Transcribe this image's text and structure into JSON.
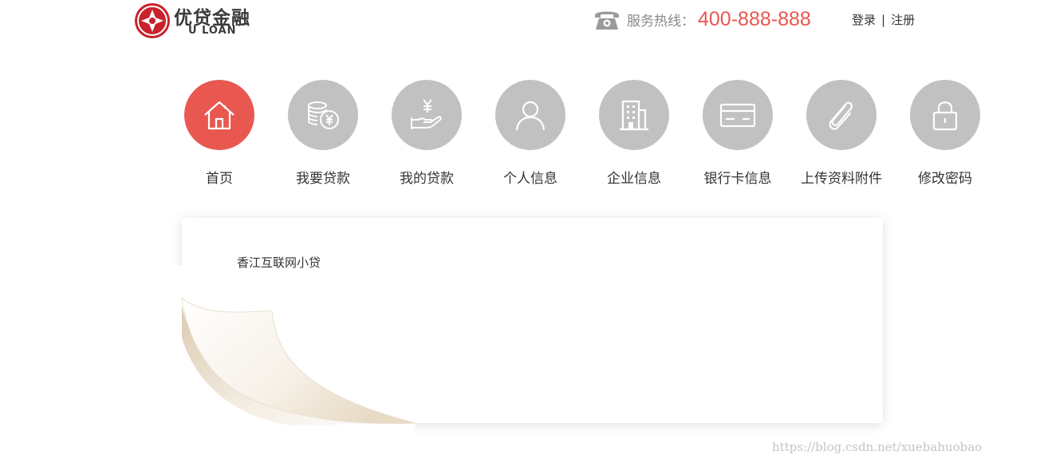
{
  "header": {
    "logo": {
      "name_cn": "优贷金融",
      "name_en": "U LOAN",
      "mark_icon": "uloan-logo-mark",
      "brand_color": "#c8232c"
    },
    "hotline": {
      "icon": "telephone-icon",
      "label": "服务热线：",
      "number": "400-888-888",
      "number_color": "#e8574f"
    },
    "auth": {
      "login": "登录",
      "separator": "|",
      "register": "注册"
    }
  },
  "nav": {
    "active_color": "#e85851",
    "inactive_color": "#c1c1c1",
    "items": [
      {
        "label": "首页",
        "icon": "home-icon",
        "active": true
      },
      {
        "label": "我要贷款",
        "icon": "coins-yen-icon",
        "active": false
      },
      {
        "label": "我的贷款",
        "icon": "hand-yen-icon",
        "active": false
      },
      {
        "label": "个人信息",
        "icon": "user-icon",
        "active": false
      },
      {
        "label": "企业信息",
        "icon": "building-icon",
        "active": false
      },
      {
        "label": "银行卡信息",
        "icon": "bank-card-icon",
        "active": false
      },
      {
        "label": "上传资料附件",
        "icon": "paperclip-icon",
        "active": false
      },
      {
        "label": "修改密码",
        "icon": "lock-icon",
        "active": false
      }
    ]
  },
  "content": {
    "title": "香江互联网小贷"
  },
  "watermark": "https://blog.csdn.net/xuebahuobao"
}
